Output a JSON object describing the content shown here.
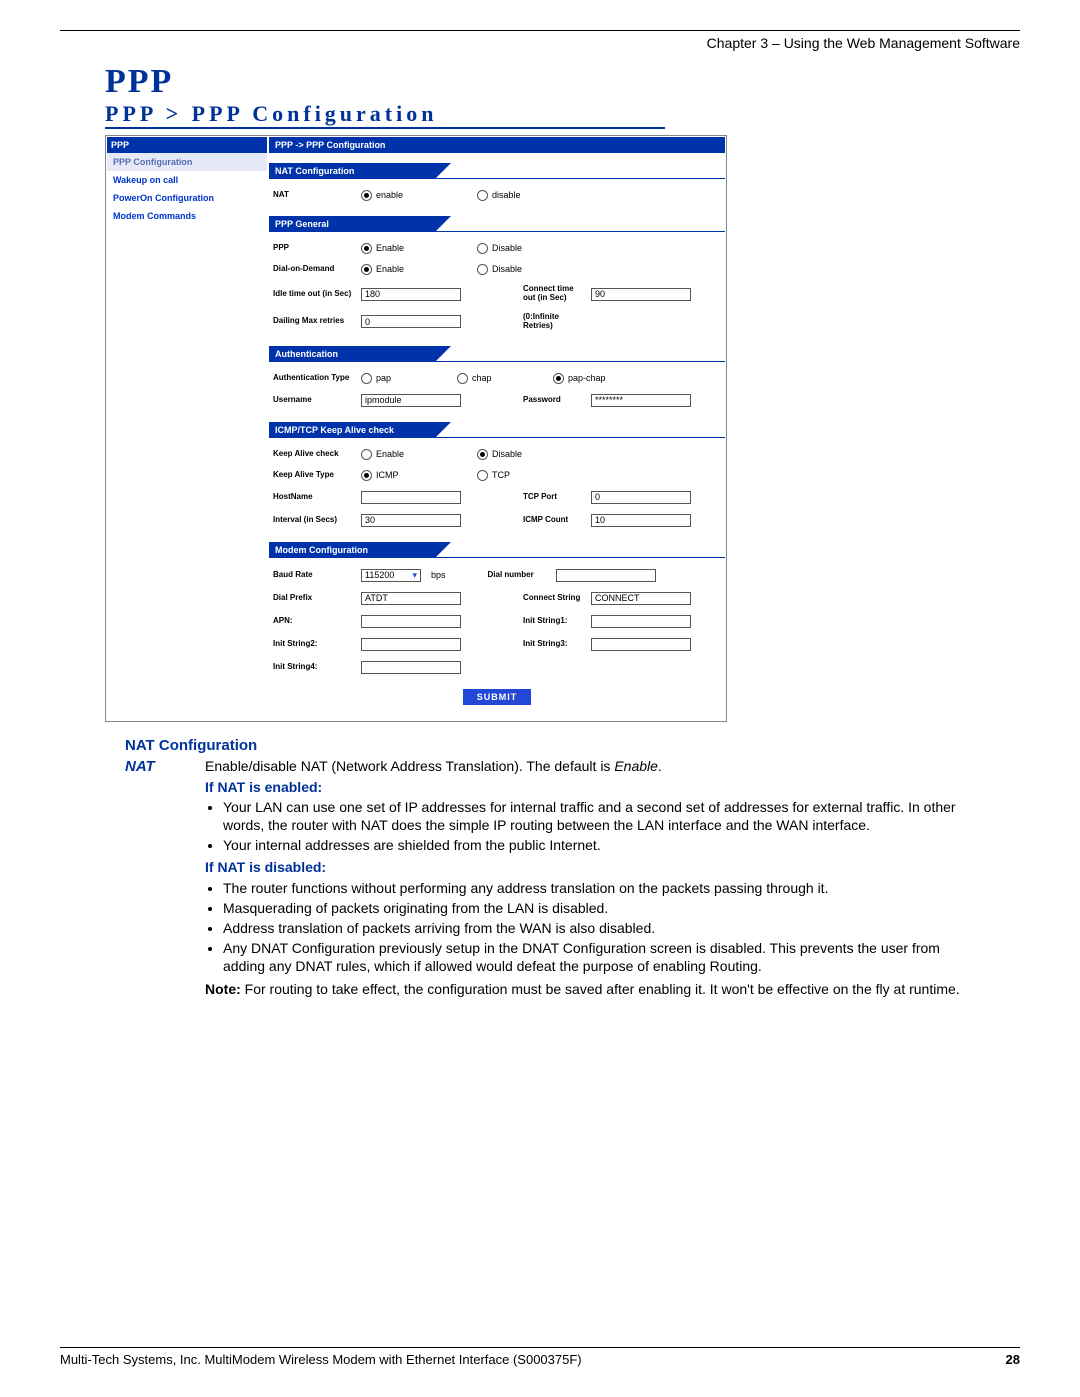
{
  "chapter": "Chapter 3 – Using the Web Management Software",
  "h1": "PPP",
  "h2": "PPP > PPP Configuration",
  "nav": {
    "title": "PPP",
    "items": [
      "PPP Configuration",
      "Wakeup on call",
      "PowerOn Configuration",
      "Modem Commands"
    ]
  },
  "crumb": "PPP  ->  PPP Configuration",
  "sections": {
    "nat": {
      "title": "NAT Configuration",
      "row": {
        "label": "NAT",
        "opt_on": "enable",
        "opt_off": "disable"
      }
    },
    "general": {
      "title": "PPP General",
      "ppp": {
        "label": "PPP",
        "on": "Enable",
        "off": "Disable"
      },
      "dod": {
        "label": "Dial-on-Demand",
        "on": "Enable",
        "off": "Disable"
      },
      "idle": {
        "label": "Idle time out   (in Sec)",
        "val": "180",
        "r_label": "Connect time out    (in Sec)",
        "r_val": "90"
      },
      "retry": {
        "label": "Dailing Max retries",
        "val": "0",
        "note": "(0:Infinite Retries)"
      }
    },
    "auth": {
      "title": "Authentication",
      "type": {
        "label": "Authentication Type",
        "pap": "pap",
        "chap": "chap",
        "both": "pap-chap"
      },
      "user": {
        "label": "Username",
        "val": "ipmodule",
        "r_label": "Password",
        "r_val": "********"
      }
    },
    "keep": {
      "title": "ICMP/TCP Keep Alive check",
      "check": {
        "label": "Keep Alive check",
        "on": "Enable",
        "off": "Disable"
      },
      "type": {
        "label": "Keep Alive Type",
        "icmp": "ICMP",
        "tcp": "TCP"
      },
      "host": {
        "label": "HostName",
        "val": "",
        "r_label": "TCP Port",
        "r_val": "0"
      },
      "int": {
        "label": "Interval (in Secs)",
        "val": "30",
        "r_label": "ICMP Count",
        "r_val": "10"
      }
    },
    "modem": {
      "title": "Modem Configuration",
      "baud": {
        "label": "Baud Rate",
        "val": "115200",
        "unit": "bps",
        "r_label": "Dial number",
        "r_val": ""
      },
      "dial": {
        "label": "Dial Prefix",
        "val": "ATDT",
        "r_label": "Connect String",
        "r_val": "CONNECT"
      },
      "apn": {
        "label": "APN:",
        "val": "",
        "r_label": "Init String1:",
        "r_val": ""
      },
      "is2": {
        "label": "Init String2:",
        "val": "",
        "r_label": "Init String3:",
        "r_val": ""
      },
      "is4": {
        "label": "Init String4:",
        "val": ""
      }
    }
  },
  "submit": "SUBMIT",
  "desc": {
    "heading": "NAT Configuration",
    "term": "NAT",
    "intro_a": "Enable/disable NAT (Network Address Translation). The default is ",
    "intro_b": "Enable",
    "intro_c": ".",
    "enabled_h": "If NAT is enabled:",
    "enabled": [
      "Your LAN can use one set of IP addresses for internal traffic and a second set of addresses for external traffic. In other words, the router with NAT does the simple IP routing between the LAN interface and the WAN interface.",
      "Your internal addresses are shielded from the public Internet."
    ],
    "disabled_h": "If NAT is disabled:",
    "disabled": [
      "The router functions without performing any address translation on the packets passing through it.",
      "Masquerading of packets originating from the LAN is disabled.",
      "Address translation of packets arriving from the WAN is also disabled.",
      "Any DNAT Configuration previously setup in the DNAT Configuration screen is disabled. This prevents the user from adding any DNAT rules, which if allowed would defeat the purpose of enabling Routing."
    ],
    "note_b": "Note:",
    "note": " For routing to take effect, the configuration must be saved after enabling it. It won't be effective on the fly at runtime."
  },
  "footer": {
    "text": "Multi-Tech Systems, Inc. MultiModem Wireless Modem with Ethernet Interface (S000375F)",
    "page": "28"
  }
}
